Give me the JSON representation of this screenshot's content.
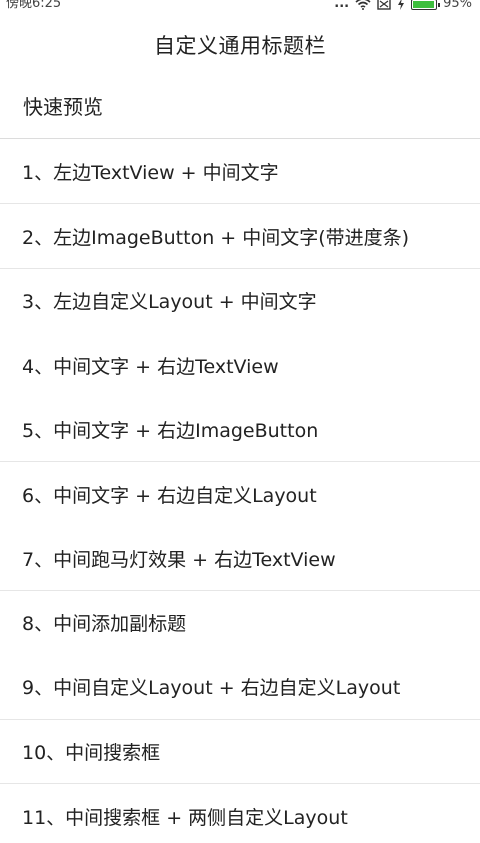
{
  "status_bar": {
    "time": "傍晚6:25",
    "more_dots": "...",
    "battery_level": 0.95,
    "battery_percent": "95%"
  },
  "title_bar": {
    "title": "自定义通用标题栏"
  },
  "section": {
    "title": "快速预览"
  },
  "menu": {
    "items": [
      {
        "label": "1、左边TextView + 中间文字"
      },
      {
        "label": "2、左边ImageButton + 中间文字(带进度条)"
      },
      {
        "label": "3、左边自定义Layout + 中间文字"
      },
      {
        "label": "4、中间文字 + 右边TextView"
      },
      {
        "label": "5、中间文字 + 右边ImageButton"
      },
      {
        "label": "6、中间文字 + 右边自定义Layout"
      },
      {
        "label": "7、中间跑马灯效果 + 右边TextView"
      },
      {
        "label": "8、中间添加副标题"
      },
      {
        "label": "9、中间自定义Layout + 右边自定义Layout"
      },
      {
        "label": "10、中间搜索框"
      },
      {
        "label": "11、中间搜索框 + 两侧自定义Layout"
      }
    ]
  },
  "colors": {
    "battery": "#3dbe3d",
    "text": "#222222",
    "divider": "#dcdcdc"
  }
}
